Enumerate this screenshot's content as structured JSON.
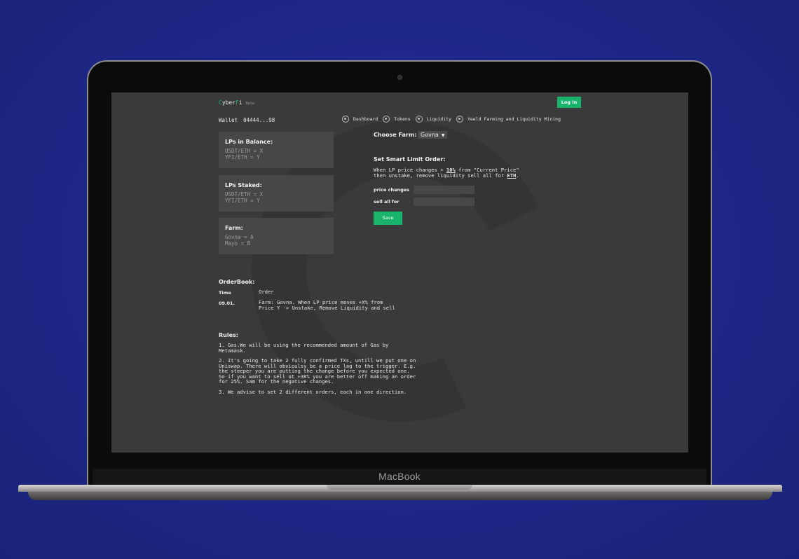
{
  "device": {
    "brand": "MacBook"
  },
  "header": {
    "logo_c": "C",
    "logo_mid": "yber",
    "logo_f": "F",
    "logo_end": "i",
    "beta": "Beta",
    "login_label": "Log In"
  },
  "wallet": {
    "label": "Wallet",
    "address": "04444...98"
  },
  "nav": {
    "items": [
      {
        "label": "Dashboard",
        "icon": "dashboard-icon"
      },
      {
        "label": "Tokens",
        "icon": "tokens-icon"
      },
      {
        "label": "Liquidity",
        "icon": "liquidity-icon"
      },
      {
        "label": "Yeeld Farming and Liquidity Mining",
        "icon": "farming-icon"
      }
    ]
  },
  "cards": {
    "balance": {
      "title": "LPs in Balance:",
      "lines": [
        "USDT/ETH = X",
        "YFI/ETH = Y"
      ]
    },
    "staked": {
      "title": "LPs Staked:",
      "lines": [
        "USDT/ETH = X",
        "YFI/ETH = Y"
      ]
    },
    "farm": {
      "title": "Farm:",
      "lines": [
        "Govna = A",
        "Mayo = B"
      ]
    }
  },
  "choose_farm": {
    "label": "Choose Farm:",
    "selected": "Govna"
  },
  "limit_order": {
    "title": "Set Smart Limit Order:",
    "line1_a": "When LP price changes + ",
    "line1_pct": "10%",
    "line1_b": " from \"Current Price\"",
    "line2_a": "then unstake, remove liquidity sell all for ",
    "line2_token": "ETH",
    "line2_b": ".",
    "price_changes_label": "price changes",
    "sell_all_for_label": "sell all for",
    "price_changes_value": "",
    "sell_all_for_value": "",
    "save_label": "Save"
  },
  "orderbook": {
    "title": "OrderBook:",
    "col_time": "Time",
    "col_order": "Order",
    "rows": [
      {
        "time": "09.01.",
        "order_line1": "Farm: Govna. When LP price moves +X% from",
        "order_line2": "Price Y -> Unstake, Remove Liquidity and sell"
      }
    ]
  },
  "rules": {
    "title": "Rules:",
    "r1_l1": "1. Gas.We will be using the recommended amount of Gas by",
    "r1_l2": "Metamask.",
    "r2_l1": "2. It's going to take 2 fully confirmed TXs, untill we put one on",
    "r2_l2": "Uniswap. There will obvioulsy be a price lag to the trigger. E.g.",
    "r2_l3": "the steeper you are putting the change before you expected one.",
    "r2_l4": "So if you want to sell at +30% you are better off making an order",
    "r2_l5": "for 25%. Sam for the negative changes.",
    "r3_l1": "3. We advise to set 2 different orders, each in one direction."
  },
  "colors": {
    "accent": "#19b36b",
    "screen_bg": "#3a3a3a",
    "card_bg": "#474747",
    "page_bg": "#1e2787"
  }
}
